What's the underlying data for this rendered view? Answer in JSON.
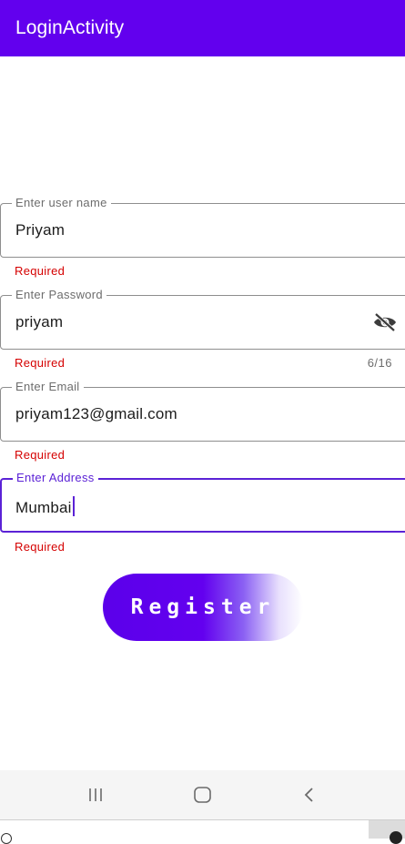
{
  "app_bar": {
    "title": "LoginActivity"
  },
  "fields": [
    {
      "label": "Enter user name",
      "value": "Priyam",
      "error": "Required"
    },
    {
      "label": "Enter Password",
      "value": "priyam",
      "error": "Required",
      "counter": "6/16",
      "icon": "visibility-off-icon"
    },
    {
      "label": "Enter Email",
      "value": "priyam123@gmail.com",
      "error": "Required"
    },
    {
      "label": "Enter Address",
      "value": "Mumbai",
      "error": "Required",
      "focused": true
    }
  ],
  "register_button": {
    "label": "Register"
  },
  "colors": {
    "primary": "#6200ee",
    "error": "#d50000",
    "focus": "#5b22d6"
  },
  "nav_bar": {
    "icons": [
      "recent-apps-icon",
      "home-icon",
      "back-icon"
    ]
  }
}
